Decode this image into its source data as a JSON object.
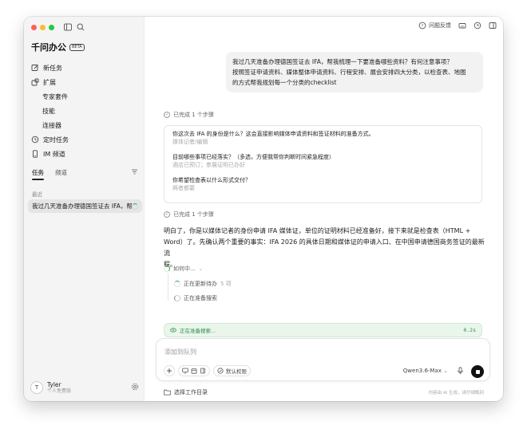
{
  "app": {
    "name": "千问办公",
    "badge": "BETA"
  },
  "sidebar": {
    "items": [
      {
        "label": "新任务",
        "icon": "edit-icon"
      },
      {
        "label": "扩展",
        "icon": "extension-icon"
      },
      {
        "label": "专家套件",
        "sub": true
      },
      {
        "label": "技能",
        "sub": true
      },
      {
        "label": "连接器",
        "sub": true
      },
      {
        "label": "定时任务",
        "icon": "clock-icon"
      },
      {
        "label": "IM 频道",
        "icon": "phone-icon"
      }
    ],
    "tabs": {
      "tasks": "任务",
      "channels": "频道"
    },
    "recent_label": "最近",
    "recent_task": "我过几天准备办理德国签证去 IFA，帮我梳理一下要准备哪些资料？",
    "user": {
      "initial": "T",
      "name": "Tyler",
      "plan": "个人免费版"
    }
  },
  "topbar": {
    "feedback": "问题反馈"
  },
  "chat": {
    "user_message": {
      "line1": "我过几天准备办理德国签证去 IFA，帮我梳理一下要准备哪些资料？有何注意事项？",
      "line2": "按照签证申请资料、媒体整体申请资料、行程安排、展会安排四大分类，以检查表、地图",
      "line3": "的方式帮我规划每一个分类的checklist"
    },
    "step1": "已完成 1 个步骤",
    "questions": [
      {
        "q": "你这次去 IFA 的身份是什么？这会直接影响媒体申请资料和签证材料的准备方式。",
        "a": "媒体记者/编辑"
      },
      {
        "q": "目前哪些事项已经落实？（多选，方便我帮你判断时间紧急程度）",
        "a": "酒店已预订；参展证明已办好"
      },
      {
        "q": "你希望检查表以什么形式交付？",
        "a": "两者都要"
      }
    ],
    "step2": "已完成 1 个步骤",
    "answer": {
      "line1": "明白了，你是以媒体记者的身份申请 IFA 媒体证，单位的证明材料已经准备好，接下来就是检查表（HTML +",
      "line2": "Word）了。先确认两个重要的事实：IFA 2026 的具体日期和媒体证的申请入口、在中国申请德国商务签证的最新流",
      "line3": "程。"
    },
    "thinking": "如何中...",
    "sub_steps": [
      {
        "label": "正在更新待办",
        "count": "5 项",
        "state": "running"
      },
      {
        "label": "正在准备搜索",
        "count": "",
        "state": "pending"
      }
    ],
    "status": {
      "label": "正在准备搜索...",
      "time": "0.2s"
    }
  },
  "composer": {
    "placeholder": "添加到队列",
    "permission": "默认权限",
    "model": "Qwen3.6-Max",
    "workdir": "选择工作目录",
    "disclaimer": "内容由 AI 生成，请仔细甄别"
  }
}
